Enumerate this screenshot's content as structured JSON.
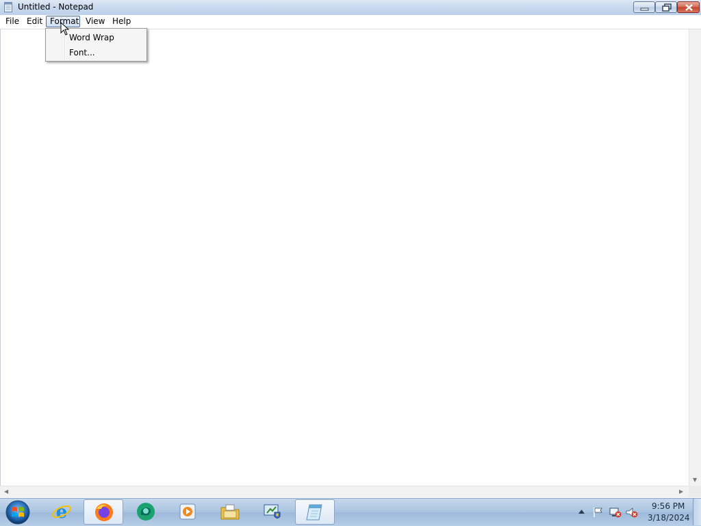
{
  "window": {
    "title": "Untitled - Notepad",
    "buttons": {
      "minimize": "minimize",
      "maximize": "restore",
      "close": "close"
    }
  },
  "menubar": {
    "items": [
      {
        "label": "File"
      },
      {
        "label": "Edit"
      },
      {
        "label": "Format",
        "active": true
      },
      {
        "label": "View"
      },
      {
        "label": "Help"
      }
    ]
  },
  "format_menu": {
    "items": [
      {
        "label": "Word Wrap"
      },
      {
        "label": "Font..."
      }
    ]
  },
  "editor": {
    "content": ""
  },
  "taskbar": {
    "start_icon": "windows-start-icon",
    "apps": [
      {
        "name": "internet-explorer-icon"
      },
      {
        "name": "firefox-icon",
        "pressed": true
      },
      {
        "name": "bing-chat-icon"
      },
      {
        "name": "media-player-icon"
      },
      {
        "name": "file-explorer-icon"
      },
      {
        "name": "control-panel-icon"
      },
      {
        "name": "notepad-icon",
        "pressed": true
      }
    ],
    "tray": {
      "icons": [
        "show-hidden-icons-arrow",
        "action-center-flag-icon",
        "network-error-icon",
        "volume-muted-icon"
      ],
      "time": "9:56 PM",
      "date": "3/18/2024"
    }
  },
  "colors": {
    "titlebar": "#c9d9ee",
    "taskbar": "#a9c3e0",
    "menu_highlight": "#cfdff3",
    "close_button": "#c2432c"
  }
}
